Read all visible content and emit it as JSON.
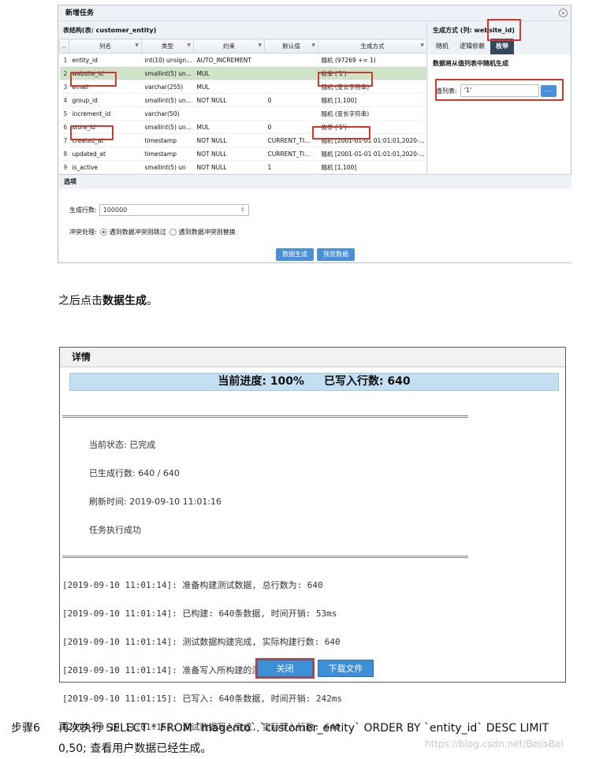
{
  "dialog1": {
    "title": "新增任务",
    "close_glyph": "×",
    "table_title": "表结构(表: customer_entity)",
    "columns": [
      "..",
      "列名",
      "类型",
      "约束",
      "默认值",
      "生成方式"
    ],
    "rows": [
      {
        "n": "1",
        "name": "entity_id",
        "type": "int(10) unsign...",
        "constraint": "AUTO_INCREMENT",
        "default": "",
        "gen": "随机 (97269 += 1)"
      },
      {
        "n": "2",
        "name": "website_id",
        "type": "smallint(5) un...",
        "constraint": "MUL",
        "default": "",
        "gen": "枚举 ('1')"
      },
      {
        "n": "3",
        "name": "email",
        "type": "varchar(255)",
        "constraint": "MUL",
        "default": "",
        "gen": "随机 (变长字符串)"
      },
      {
        "n": "4",
        "name": "group_id",
        "type": "smallint(5) un...",
        "constraint": "NOT NULL",
        "default": "0",
        "gen": "随机 [1,100]"
      },
      {
        "n": "5",
        "name": "increment_id",
        "type": "varchar(50)",
        "constraint": "",
        "default": "",
        "gen": "随机 (变长字符串)"
      },
      {
        "n": "6",
        "name": "store_id",
        "type": "smallint(5) un...",
        "constraint": "MUL",
        "default": "0",
        "gen": "枚举 ('1')"
      },
      {
        "n": "7",
        "name": "created_at",
        "type": "timestamp",
        "constraint": "NOT NULL",
        "default": "CURRENT_TI...",
        "gen": "随机 [2001-01-01 01:01:01,2020-..."
      },
      {
        "n": "8",
        "name": "updated_at",
        "type": "timestamp",
        "constraint": "NOT NULL",
        "default": "CURRENT_TI...",
        "gen": "随机 [2001-01-01 01:01:01,2020-..."
      },
      {
        "n": "9",
        "name": "is_active",
        "type": "smallint(5) un",
        "constraint": "NOT NULL",
        "default": "1",
        "gen": "随机 [1,100]"
      }
    ],
    "gen_method_title": "生成方式 (列: website_id)",
    "tabs": [
      "随机",
      "逻辑依赖",
      "枚举"
    ],
    "active_tab": "枚举",
    "enum_note": "数据将从值列表中随机生成",
    "value_list_label": "值列表:",
    "value_list_value": "'1'",
    "value_list_button": "...",
    "options_title": "选项",
    "rows_label": "生成行数:",
    "rows_value": "100000",
    "spin_glyph": "⇕",
    "conflict_label": "冲突处理:",
    "conflict_skip": "遇到数据冲突则跳过",
    "conflict_replace": "遇到数据冲突则替换",
    "btn_generate": "数据生成",
    "btn_preview": "预览数据"
  },
  "paragraph1": {
    "prefix": "之后点击",
    "bold": "数据生成",
    "suffix": "。"
  },
  "dialog2": {
    "title": "详情",
    "progress_label": "当前进度: 100%",
    "written_label": "已写入行数: 640",
    "separator": "============================================================",
    "status": [
      "当前状态: 已完成",
      "已生成行数: 640 / 640",
      "刷新时间: 2019-09-10 11:01:16",
      "任务执行成功"
    ],
    "log": [
      "[2019-09-10 11:01:14]: 准备构建测试数据, 总行数为: 640",
      "[2019-09-10 11:01:14]: 已构建: 640条数据, 时间开销: 53ms",
      "[2019-09-10 11:01:14]: 测试数据构建完成, 实际构建行数: 640",
      "[2019-09-10 11:01:14]: 准备写入所构建的测试数据",
      "[2019-09-10 11:01:15]: 已写入: 640条数据, 时间开销: 242ms",
      "[2019-09-10 11:01:15]: 测试数据写入完成, 实际写入行数: 640"
    ],
    "btn_close": "关闭",
    "btn_download": "下载文件"
  },
  "step6": {
    "label": "步骤6",
    "text": "再次执行 SELECT * FROM `magento`.`customer_entity` ORDER BY `entity_id` DESC LIMIT 0,50; 查看用户数据已经生成。"
  },
  "watermark": "https://blog.csdn.net/BeiisBei"
}
